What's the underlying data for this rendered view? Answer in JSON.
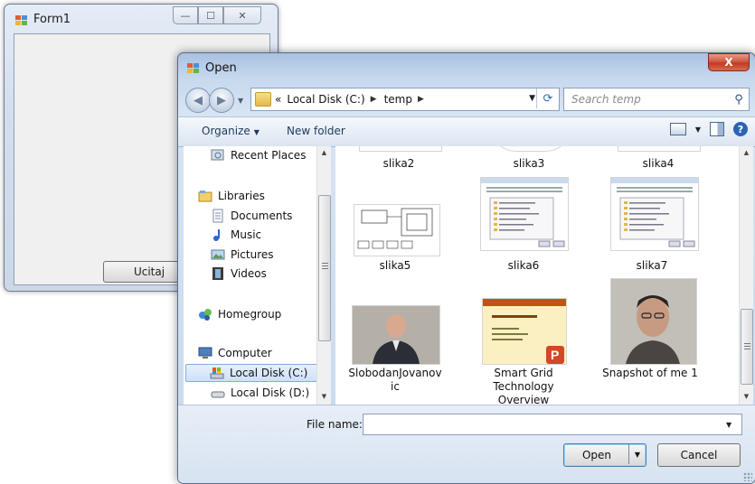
{
  "form1": {
    "title": "Form1",
    "button_label": "Ucitaj",
    "caption_buttons": {
      "minimize": "—",
      "maximize": "☐",
      "close": "✕"
    }
  },
  "dialog": {
    "title": "Open",
    "close_glyph": "X",
    "address": {
      "prefix": "«",
      "crumbs": [
        "Local Disk (C:)",
        "temp"
      ]
    },
    "search": {
      "placeholder": "Search temp"
    },
    "toolbar": {
      "organize": "Organize",
      "new_folder": "New folder"
    },
    "nav_pane": {
      "items": [
        {
          "label": "Recent Places",
          "icon": "recent-places-icon"
        },
        {
          "label": "Libraries",
          "icon": "libraries-icon"
        },
        {
          "label": "Documents",
          "icon": "documents-icon"
        },
        {
          "label": "Music",
          "icon": "music-icon"
        },
        {
          "label": "Pictures",
          "icon": "pictures-icon"
        },
        {
          "label": "Videos",
          "icon": "videos-icon"
        },
        {
          "label": "Homegroup",
          "icon": "homegroup-icon"
        },
        {
          "label": "Computer",
          "icon": "computer-icon"
        },
        {
          "label": "Local Disk (C:)",
          "icon": "local-disk-icon",
          "selected": true
        },
        {
          "label": "Local Disk (D:)",
          "icon": "local-disk-icon"
        }
      ]
    },
    "files": [
      {
        "name": "slika2"
      },
      {
        "name": "slika3"
      },
      {
        "name": "slika4"
      },
      {
        "name": "slika5"
      },
      {
        "name": "slika6"
      },
      {
        "name": "slika7"
      },
      {
        "name": "SlobodanJovanov\nic"
      },
      {
        "name": "Smart Grid\nTechnology\nOverview"
      },
      {
        "name": "Snapshot of me 1"
      }
    ],
    "bottom": {
      "file_name_label": "File name:",
      "file_name_value": "",
      "open_button": "Open",
      "cancel_button": "Cancel"
    }
  }
}
